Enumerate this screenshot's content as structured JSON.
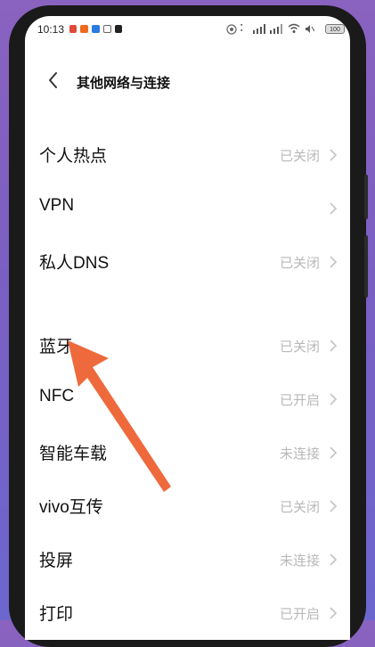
{
  "status_bar": {
    "time": "10:13",
    "battery": "100"
  },
  "header": {
    "title": "其他网络与连接"
  },
  "rows": [
    {
      "label": "个人热点",
      "value": "已关闭"
    },
    {
      "label": "VPN",
      "value": ""
    },
    {
      "label": "私人DNS",
      "value": "已关闭"
    },
    {
      "label": "蓝牙",
      "value": "已关闭"
    },
    {
      "label": "NFC",
      "value": "已开启"
    },
    {
      "label": "智能车载",
      "value": "未连接"
    },
    {
      "label": "vivo互传",
      "value": "已关闭"
    },
    {
      "label": "投屏",
      "value": "未连接"
    },
    {
      "label": "打印",
      "value": "已开启"
    }
  ],
  "colors": {
    "accent_arrow": "#ee6a3c",
    "value_text": "#b8b8b8"
  }
}
